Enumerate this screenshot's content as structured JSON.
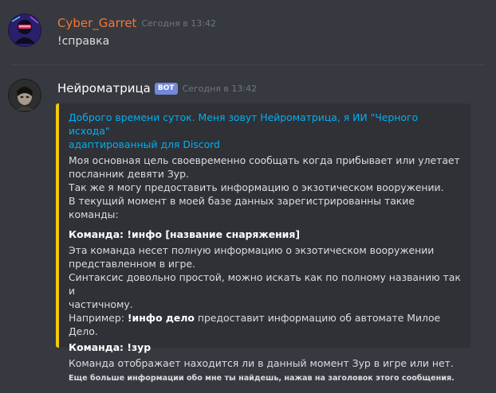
{
  "messages": [
    {
      "author": "Cyber_Garret",
      "author_color": "#f57731",
      "timestamp": "Сегодня в 13:42",
      "content": "!справка"
    },
    {
      "author": "Нейроматрица",
      "author_color": "#ffffff",
      "bot_tag": "BOT",
      "timestamp": "Сегодня в 13:42",
      "embed": {
        "accent_color": "#f2c80d",
        "title_line1": "Доброго времени суток. Меня зовут Нейроматрица, я ИИ \"Черного исхода\"",
        "title_line2": "адаптированный для Discord",
        "desc_lines": [
          "Моя основная цель своевременно сообщать когда прибывает или улетает",
          "посланник девяти Зур.",
          "Так же я могу предоставить информацию о экзотическом вооружении.",
          "В текущий момент в моей базе данных зарегистрированны такие команды:"
        ],
        "field1": {
          "name_prefix": "Команда: ",
          "name_cmd": "!инфо [название снаряжения]",
          "lines": [
            "Эта команда несет полную информацию о экзотическом вооружении",
            "представленном в игре.",
            "Синтаксис довольно простой, можно искать как по полному названию так и",
            "частичному."
          ],
          "example_prefix": "Например: ",
          "example_cmd": "!инфо дело",
          "example_suffix": " предоставит информацию об автомате Милое Дело."
        },
        "field2": {
          "name_prefix": "Команда: ",
          "name_cmd": "!зур",
          "value": "Команда отображает находится ли в данный момент Зур в игре или нет."
        },
        "footer": "Еще больше информации обо мне ты найдешь, нажав на заголовок этого сообщения."
      }
    }
  ]
}
